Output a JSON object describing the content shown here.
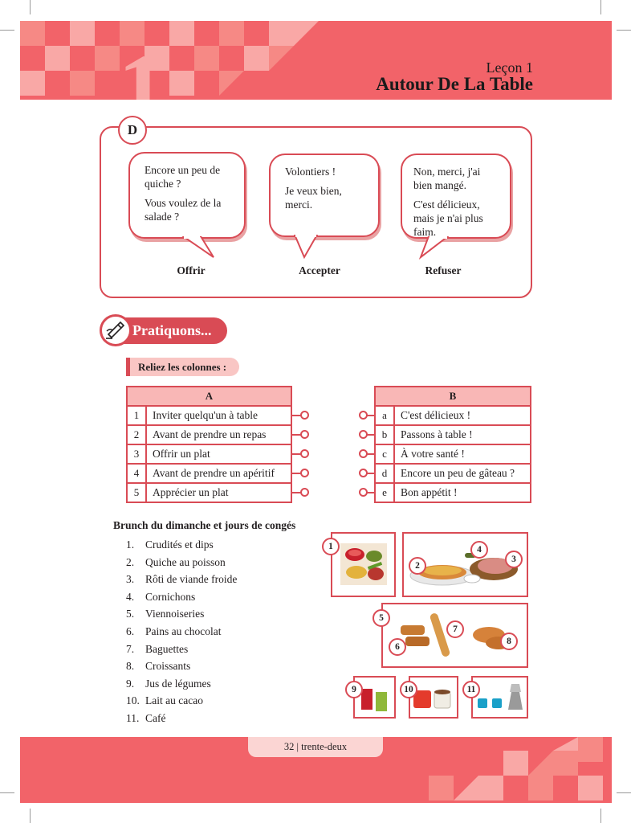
{
  "header": {
    "big_number": "1",
    "lesson_label": "Leçon 1",
    "lesson_title": "Autour De La Table"
  },
  "section_d": {
    "badge": "D",
    "bubbles": [
      {
        "lines": [
          "Encore un peu de quiche ?",
          "Vous voulez de la salade ?"
        ],
        "label": "Offrir"
      },
      {
        "lines": [
          "Volontiers !",
          "Je veux bien, merci."
        ],
        "label": "Accepter"
      },
      {
        "lines": [
          "Non, merci, j'ai bien mangé.",
          "C'est délicieux, mais je n'ai plus faim."
        ],
        "label": "Refuser"
      }
    ]
  },
  "practice": {
    "title": "Pratiquons...",
    "icon": "writing-hand-icon",
    "instruction": "Reliez les colonnes :"
  },
  "table_a": {
    "header": "A",
    "rows": [
      {
        "num": "1",
        "text": "Inviter quelqu'un à table"
      },
      {
        "num": "2",
        "text": "Avant de prendre un repas"
      },
      {
        "num": "3",
        "text": "Offrir un plat"
      },
      {
        "num": "4",
        "text": "Avant de prendre un apéritif"
      },
      {
        "num": "5",
        "text": "Apprécier un plat"
      }
    ]
  },
  "table_b": {
    "header": "B",
    "rows": [
      {
        "letter": "a",
        "text": "C'est délicieux !"
      },
      {
        "letter": "b",
        "text": "Passons à table !"
      },
      {
        "letter": "c",
        "text": "À votre santé !"
      },
      {
        "letter": "d",
        "text": "Encore un peu de gâteau ?"
      },
      {
        "letter": "e",
        "text": "Bon appétit !"
      }
    ]
  },
  "brunch": {
    "title": "Brunch du dimanche et jours de congés",
    "items": [
      {
        "n": "1.",
        "text": "Crudités et dips"
      },
      {
        "n": "2.",
        "text": "Quiche au poisson"
      },
      {
        "n": "3.",
        "text": "Rôti de viande froide"
      },
      {
        "n": "4.",
        "text": "Cornichons"
      },
      {
        "n": "5.",
        "text": "Viennoiseries"
      },
      {
        "n": "6.",
        "text": "Pains au chocolat"
      },
      {
        "n": "7.",
        "text": "Baguettes"
      },
      {
        "n": "8.",
        "text": "Croissants"
      },
      {
        "n": "9.",
        "text": "Jus de légumes"
      },
      {
        "n": "10.",
        "text": "Lait au cacao"
      },
      {
        "n": "11.",
        "text": "Café"
      }
    ],
    "photo_numbers": [
      "1",
      "2",
      "3",
      "4",
      "5",
      "6",
      "7",
      "8",
      "9",
      "10",
      "11"
    ]
  },
  "footer": {
    "page": "32 | trente-deux"
  },
  "colors": {
    "banner": "#f26369",
    "accent": "#d94b55",
    "light": "#f9b7b6"
  }
}
